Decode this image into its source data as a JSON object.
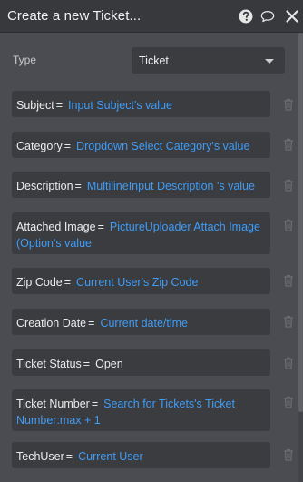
{
  "header": {
    "title": "Create a new Ticket...",
    "icons": [
      "help-icon",
      "comment-icon",
      "close-icon"
    ]
  },
  "type_field": {
    "label": "Type",
    "value": "Ticket"
  },
  "fields": [
    {
      "label": "Subject",
      "eq": "=",
      "value": "Input Subject's value"
    },
    {
      "label": "Category",
      "eq": "=",
      "value": "Dropdown Select Category's value"
    },
    {
      "label": "Description",
      "eq": "=",
      "value": "MultilineInput Description 's value"
    },
    {
      "label": "Attached Image",
      "eq": "=",
      "value": "PictureUploader Attach Image (Option's value"
    },
    {
      "label": "Zip Code",
      "eq": "=",
      "value": "Current User's Zip Code"
    },
    {
      "label": "Creation Date",
      "eq": "=",
      "value": "Current date/time"
    },
    {
      "label": "Ticket Status",
      "eq": "=",
      "value": "Open"
    },
    {
      "label": "Ticket Number",
      "eq": "=",
      "value": "Search for Tickets's Ticket Number:max + 1"
    },
    {
      "label": "TechUser",
      "eq": "=",
      "value": "Current User"
    }
  ],
  "colors": {
    "background": "#4b4c51",
    "header": "#38393d",
    "row": "#3b3c40",
    "link": "#3f9cf5",
    "text": "#ececec"
  }
}
